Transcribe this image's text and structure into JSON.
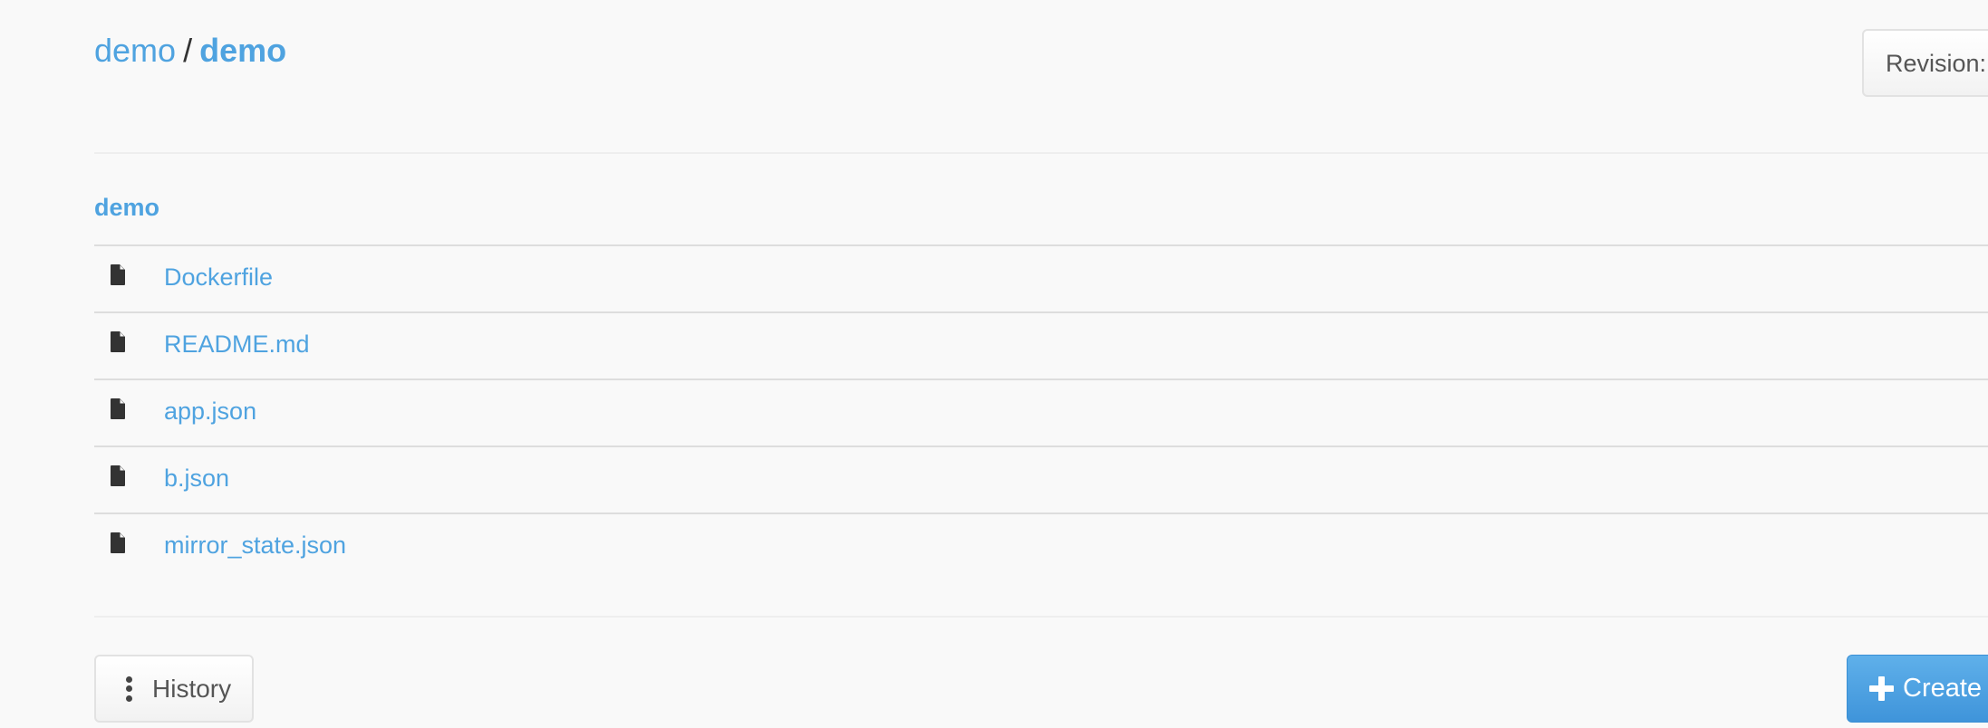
{
  "header": {
    "breadcrumb": [
      {
        "label": "demo",
        "current": false
      },
      {
        "label": "demo",
        "current": true
      }
    ],
    "separator": "/",
    "revision_button_label": "Revision:"
  },
  "folder": {
    "name": "demo",
    "files": [
      {
        "name": "Dockerfile",
        "icon": "file-icon"
      },
      {
        "name": "README.md",
        "icon": "file-icon"
      },
      {
        "name": "app.json",
        "icon": "file-icon"
      },
      {
        "name": "b.json",
        "icon": "file-icon"
      },
      {
        "name": "mirror_state.json",
        "icon": "file-icon"
      }
    ]
  },
  "footer": {
    "history_label": "History",
    "history_icon": "vertical-ellipsis-icon",
    "create_label": "Create",
    "create_icon": "plus-icon"
  },
  "colors": {
    "link": "#4fa3e0",
    "primary_button": "#4a9fe0",
    "background": "#f9f9f9"
  }
}
